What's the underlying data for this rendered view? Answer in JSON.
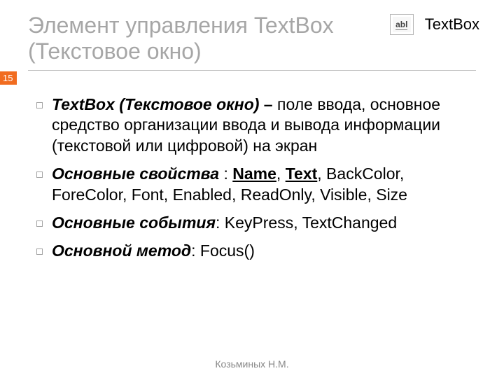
{
  "slide": {
    "title": "Элемент управления TextBox (Текстовое окно)",
    "page_number": "15",
    "icon_label": "TextBox",
    "icon_text": "abl",
    "footer": "Козьминых Н.М."
  },
  "bullets": [
    {
      "lead_bold_italic": "TextBox (Текстовое окно)",
      "lead_bold": " – ",
      "rest": "поле ввода, основное средство организации ввода и вывода информации (текстовой или цифровой) на экран"
    },
    {
      "lead_bold_italic": "Основные свойства",
      "lead_bold": " : ",
      "props_underlined_1": "Name",
      "props_sep_1": ", ",
      "props_underlined_2": "Text",
      "props_rest": ", BackColor, ForeColor, Font, Enabled, ReadOnly, Visible, Size"
    },
    {
      "lead_bold_italic": "Основные события",
      "lead_bold": ": ",
      "rest": "KeyPress, TextChanged"
    },
    {
      "lead_bold_italic": "Основной метод",
      "lead_bold": ": ",
      "rest": "Focus()"
    }
  ]
}
